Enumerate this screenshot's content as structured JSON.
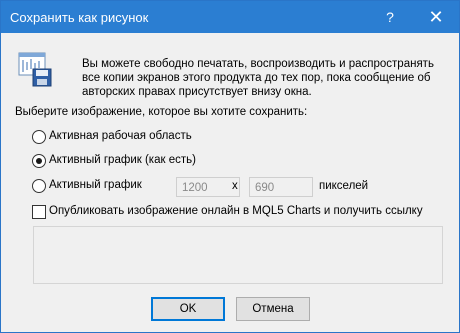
{
  "window": {
    "title": "Сохранить как рисунок",
    "help_glyph": "?",
    "close_glyph": "✕"
  },
  "info": {
    "text": "Вы можете свободно печатать, воспроизводить и распространять все копии экранов этого продукта до тех пор, пока сообщение об авторских правах присутствует внизу окна.",
    "icon": "save-chart-icon"
  },
  "select_label": "Выберите изображение, которое вы хотите сохранить:",
  "options": [
    {
      "label": "Активная рабочая область",
      "selected": false
    },
    {
      "label": "Активный график (как есть)",
      "selected": true
    },
    {
      "label": "Активный график",
      "selected": false
    }
  ],
  "size": {
    "width": "1200",
    "x_sign": "x",
    "height": "690",
    "unit": "пикселей"
  },
  "publish": {
    "label": "Опубликовать изображение онлайн в MQL5 Charts и получить ссылку",
    "checked": false,
    "link_value": ""
  },
  "buttons": {
    "ok": "OK",
    "cancel": "Отмена"
  },
  "colors": {
    "titlebar": "#2b7ed2",
    "dialog_bg": "#f0f0f0",
    "default_button_border": "#0078d7"
  }
}
